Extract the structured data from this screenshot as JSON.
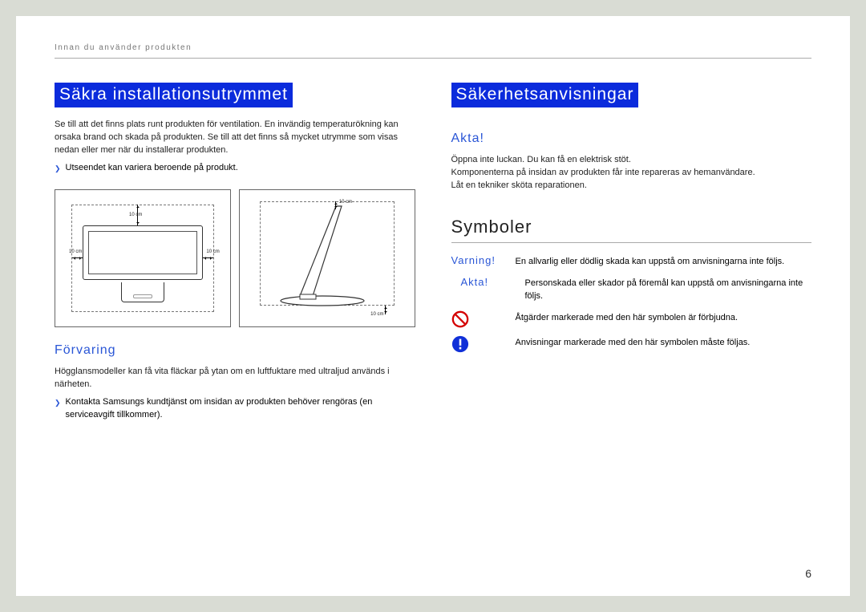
{
  "running_head": "Innan du använder produkten",
  "page_number": "6",
  "left": {
    "heading": "Säkra installationsutrymmet",
    "intro": "Se till att det finns plats runt produkten för ventilation. En invändig temperaturökning kan orsaka brand och skada på produkten. Se till att det finns så mycket utrymme som visas nedan eller mer när du installerar produkten.",
    "note": "Utseendet kan variera beroende på produkt.",
    "dims": {
      "top": "10 cm",
      "left": "10 cm",
      "right": "10 cm",
      "bottom": "10 cm"
    },
    "storage_h": "Förvaring",
    "storage_p": "Högglansmodeller kan få vita fläckar på ytan om en luftfuktare med ultraljud används i närheten.",
    "storage_b": "Kontakta Samsungs kundtjänst om insidan av produkten behöver rengöras (en serviceavgift tillkommer)."
  },
  "right": {
    "heading": "Säkerhetsanvisningar",
    "caution_h": "Akta!",
    "caution_lines": [
      "Öppna inte luckan. Du kan få en elektrisk stöt.",
      "Komponenterna på insidan av produkten får inte repareras av hemanvändare.",
      "Låt en tekniker sköta reparationen."
    ],
    "symbols_h": "Symboler",
    "rows": [
      {
        "label": "Varning!",
        "text": "En allvarlig eller dödlig skada kan uppstå om anvisningarna inte följs."
      },
      {
        "label": "Akta!",
        "text": "Personskada eller skador på föremål kan uppstå om anvisningarna inte följs."
      },
      {
        "icon": "forbidden",
        "text": "Åtgärder markerade med den här symbolen är förbjudna."
      },
      {
        "icon": "must",
        "text": "Anvisningar markerade med den här symbolen måste följas."
      }
    ]
  }
}
